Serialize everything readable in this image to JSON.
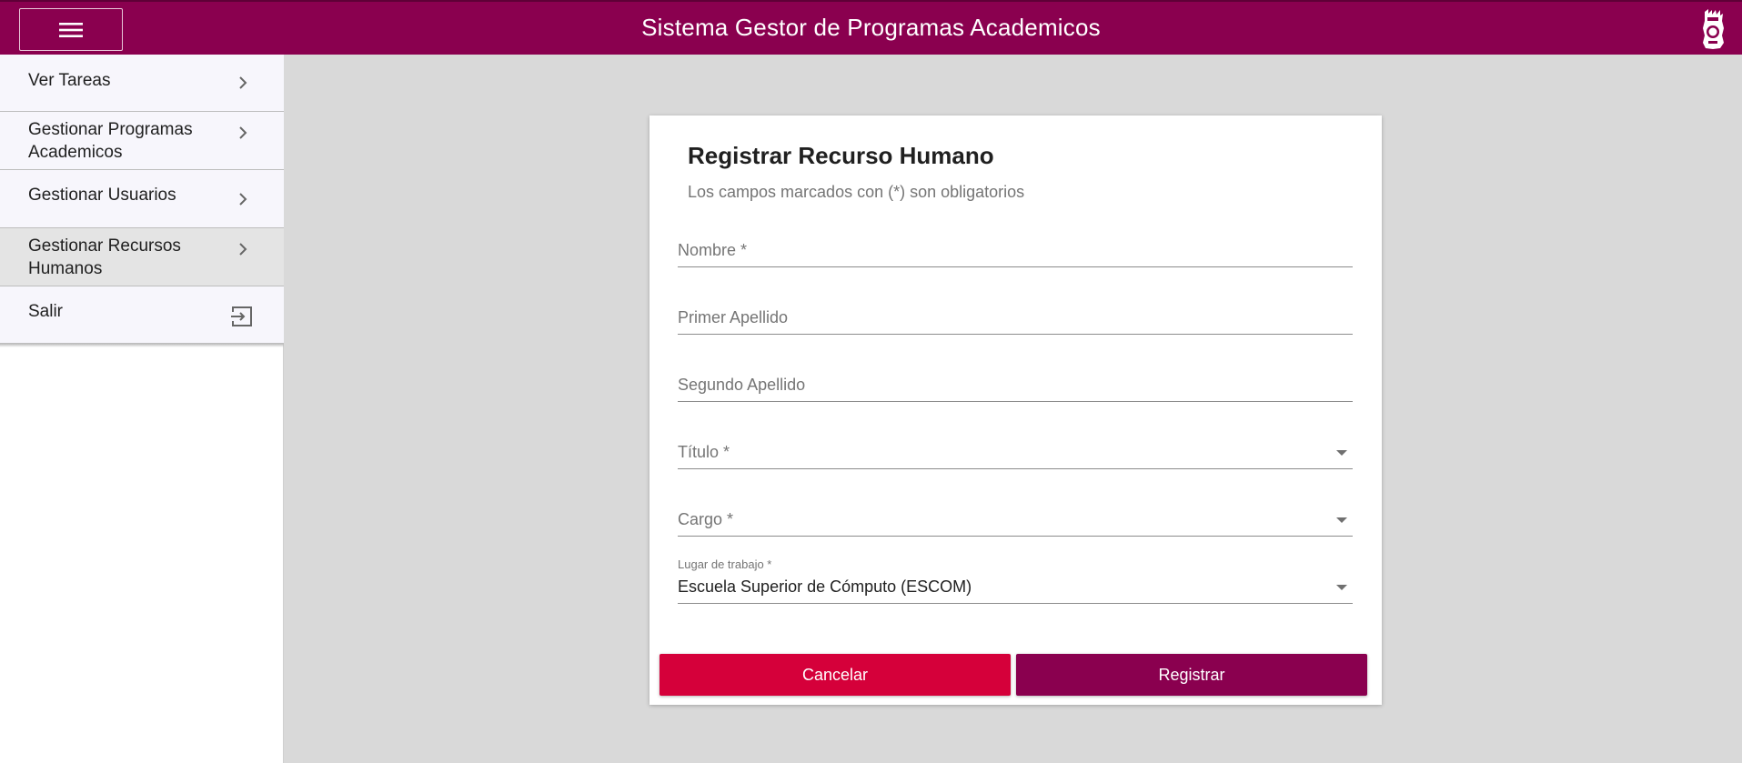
{
  "header": {
    "title": "Sistema Gestor de Programas Academicos",
    "menu_icon": "hamburger-menu-icon",
    "logo_icon": "institution-logo-icon",
    "brand_color": "#8a004f"
  },
  "sidebar": {
    "items": [
      {
        "label": "Ver Tareas",
        "icon": "chevron-right-icon"
      },
      {
        "label": "Gestionar Programas Academicos",
        "icon": "chevron-right-icon"
      },
      {
        "label": "Gestionar Usuarios",
        "icon": "chevron-right-icon"
      },
      {
        "label": "Gestionar Recursos Humanos",
        "icon": "chevron-right-icon",
        "active": true
      },
      {
        "label": "Salir",
        "icon": "exit-icon"
      }
    ]
  },
  "form": {
    "title": "Registrar Recurso Humano",
    "subtitle": "Los campos marcados con (*) son obligatorios",
    "fields": {
      "nombre": {
        "placeholder": "Nombre *",
        "value": ""
      },
      "primer_apellido": {
        "placeholder": "Primer Apellido",
        "value": ""
      },
      "segundo_apellido": {
        "placeholder": "Segundo Apellido",
        "value": ""
      },
      "titulo": {
        "placeholder": "Título *",
        "value": ""
      },
      "cargo": {
        "placeholder": "Cargo *",
        "value": ""
      },
      "lugar_trabajo": {
        "label": "Lugar de trabajo *",
        "value": "Escuela Superior de Cómputo (ESCOM)"
      }
    },
    "buttons": {
      "cancel_label": "Cancelar",
      "submit_label": "Registrar",
      "cancel_color": "#d5003a",
      "submit_color": "#8a004f"
    }
  }
}
